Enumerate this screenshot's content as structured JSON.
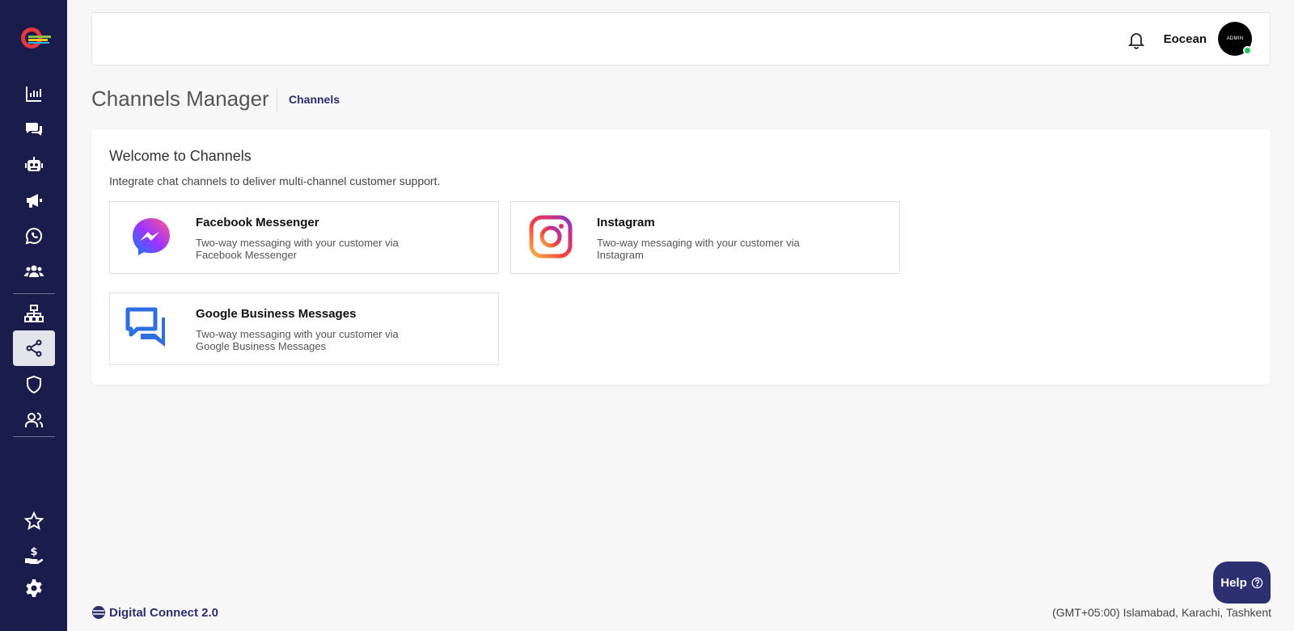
{
  "header": {
    "username": "Eocean",
    "avatar_text": "ADMIN"
  },
  "page": {
    "title": "Channels Manager",
    "breadcrumb": "Channels"
  },
  "card": {
    "title": "Welcome to Channels",
    "subtitle": "Integrate chat channels to deliver multi-channel customer support."
  },
  "channels": [
    {
      "name": "Facebook Messenger",
      "description": "Two-way messaging with your customer via Facebook Messenger",
      "icon": "messenger-icon"
    },
    {
      "name": "Instagram",
      "description": "Two-way messaging with your customer via Instagram",
      "icon": "instagram-icon"
    },
    {
      "name": "Google Business Messages",
      "description": "Two-way messaging with your customer via Google Business Messages",
      "icon": "google-business-messages-icon"
    }
  ],
  "sidebar": {
    "items": [
      {
        "name": "analytics",
        "icon": "bar-chart-icon"
      },
      {
        "name": "conversations",
        "icon": "chat-bubbles-icon"
      },
      {
        "name": "bots",
        "icon": "robot-icon"
      },
      {
        "name": "campaigns",
        "icon": "megaphone-icon"
      },
      {
        "name": "whatsapp",
        "icon": "whatsapp-icon"
      },
      {
        "name": "contacts",
        "icon": "users-icon"
      },
      {
        "name": "integrations",
        "icon": "network-icon"
      },
      {
        "name": "channels",
        "icon": "share-icon",
        "active": true
      },
      {
        "name": "security",
        "icon": "shield-icon"
      },
      {
        "name": "team",
        "icon": "user-group-icon"
      },
      {
        "name": "favorites",
        "icon": "star-icon"
      },
      {
        "name": "billing",
        "icon": "hand-dollar-icon"
      },
      {
        "name": "settings",
        "icon": "gear-icon"
      }
    ]
  },
  "footer": {
    "brand": "Digital Connect 2.0",
    "timezone": "(GMT+05:00) Islamabad, Karachi, Tashkent"
  },
  "help": {
    "label": "Help"
  },
  "colors": {
    "sidebar_bg": "#1a1c4b",
    "accent": "#2c2f6b",
    "help_bg": "#2d3070",
    "online": "#22c55e"
  }
}
